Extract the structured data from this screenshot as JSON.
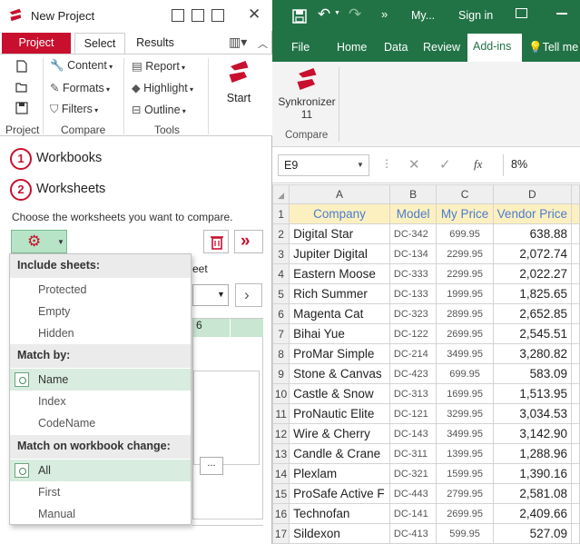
{
  "left": {
    "title": "New Project",
    "tabs": [
      "Project",
      "Select",
      "Results"
    ],
    "ribbon": {
      "project_group_label": "Project",
      "compare_items": [
        "Content",
        "Formats",
        "Filters"
      ],
      "compare_group_label": "Compare",
      "tools_items": [
        "Report",
        "Highlight",
        "Outline"
      ],
      "tools_group_label": "Tools",
      "start_label": "Start"
    },
    "steps": [
      {
        "num": "1",
        "label": "Workbooks"
      },
      {
        "num": "2",
        "label": "Worksheets"
      }
    ],
    "choose_text": "Choose the worksheets you want to compare.",
    "behind_text": "eet",
    "behind_col": "6",
    "ellipsis": "...",
    "dropdown": {
      "include_header": "Include sheets:",
      "include_items": [
        "Protected",
        "Empty",
        "Hidden"
      ],
      "match_header": "Match by:",
      "match_items": [
        "Name",
        "Index",
        "CodeName"
      ],
      "match_selected": "Name",
      "change_header": "Match on workbook change:",
      "change_items": [
        "All",
        "First",
        "Manual"
      ],
      "change_selected": "All"
    }
  },
  "excel": {
    "title": "My...",
    "sign_in": "Sign in",
    "tabs": [
      "File",
      "Home",
      "Data",
      "Review",
      "Add-ins",
      "Tell me"
    ],
    "active_tab": "Add-ins",
    "addin_name": "Synkronizer",
    "addin_version": "11",
    "group_label": "Compare",
    "name_box": "E9",
    "formula_value": "8%",
    "fx": "fx",
    "columns": [
      "A",
      "B",
      "C",
      "D"
    ],
    "headers": [
      "Company",
      "Model",
      "My Price",
      "Vendor Price"
    ],
    "rows": [
      {
        "row": "2",
        "company": "Digital Star",
        "model": "DC-342",
        "my_price": "699.95",
        "vendor_price": "638.88"
      },
      {
        "row": "3",
        "company": "Jupiter Digital",
        "model": "DC-134",
        "my_price": "2299.95",
        "vendor_price": "2,072.74"
      },
      {
        "row": "4",
        "company": "Eastern Moose",
        "model": "DC-333",
        "my_price": "2299.95",
        "vendor_price": "2,022.27"
      },
      {
        "row": "5",
        "company": "Rich Summer",
        "model": "DC-133",
        "my_price": "1999.95",
        "vendor_price": "1,825.65"
      },
      {
        "row": "6",
        "company": "Magenta Cat",
        "model": "DC-323",
        "my_price": "2899.95",
        "vendor_price": "2,652.85"
      },
      {
        "row": "7",
        "company": "Bihai Yue",
        "model": "DC-122",
        "my_price": "2699.95",
        "vendor_price": "2,545.51"
      },
      {
        "row": "8",
        "company": "ProMar Simple",
        "model": "DC-214",
        "my_price": "3499.95",
        "vendor_price": "3,280.82"
      },
      {
        "row": "9",
        "company": "Stone & Canvas",
        "model": "DC-423",
        "my_price": "699.95",
        "vendor_price": "583.09"
      },
      {
        "row": "10",
        "company": "Castle & Snow",
        "model": "DC-313",
        "my_price": "1699.95",
        "vendor_price": "1,513.95"
      },
      {
        "row": "11",
        "company": "ProNautic Elite",
        "model": "DC-121",
        "my_price": "3299.95",
        "vendor_price": "3,034.53"
      },
      {
        "row": "12",
        "company": "Wire & Cherry",
        "model": "DC-143",
        "my_price": "3499.95",
        "vendor_price": "3,142.90"
      },
      {
        "row": "13",
        "company": "Candle & Crane",
        "model": "DC-311",
        "my_price": "1399.95",
        "vendor_price": "1,288.96"
      },
      {
        "row": "14",
        "company": "Plexlam",
        "model": "DC-321",
        "my_price": "1599.95",
        "vendor_price": "1,390.16"
      },
      {
        "row": "15",
        "company": "ProSafe Active F",
        "model": "DC-443",
        "my_price": "2799.95",
        "vendor_price": "2,581.08"
      },
      {
        "row": "16",
        "company": "Technofan",
        "model": "DC-141",
        "my_price": "2699.95",
        "vendor_price": "2,409.66"
      },
      {
        "row": "17",
        "company": "Sildexon",
        "model": "DC-413",
        "my_price": "599.95",
        "vendor_price": "527.09"
      }
    ]
  },
  "colors": {
    "accent_red": "#c8102e",
    "excel_green": "#217346",
    "highlight_green": "#b7e4c7"
  }
}
